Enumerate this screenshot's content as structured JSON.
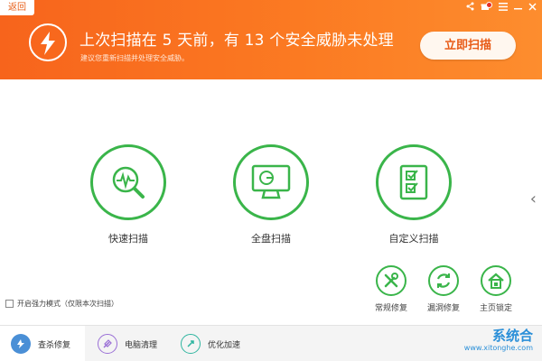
{
  "header": {
    "back_label": "返回",
    "headline": "上次扫描在 5 天前，有 13 个安全威胁未处理",
    "subline": "建议您重新扫描并处理安全威胁。",
    "scan_now_label": "立即扫描",
    "colors": {
      "bg_start": "#f7641c",
      "bg_end": "#fd8d2e",
      "accent_green": "#3ab54a"
    }
  },
  "window_controls": {
    "share": "share-icon",
    "gift": "gift-icon",
    "menu": "menu-icon",
    "minimize": "minimize-icon",
    "close": "close-icon"
  },
  "scan_options": [
    {
      "label": "快速扫描",
      "icon": "quick-scan-icon"
    },
    {
      "label": "全盘扫描",
      "icon": "full-scan-icon"
    },
    {
      "label": "自定义扫描",
      "icon": "custom-scan-icon"
    }
  ],
  "tools": [
    {
      "label": "常规修复",
      "icon": "wrench-icon"
    },
    {
      "label": "漏洞修复",
      "icon": "patch-icon"
    },
    {
      "label": "主页锁定",
      "icon": "home-lock-icon"
    }
  ],
  "force_mode": {
    "label": "开启强力模式（仅限本次扫描）",
    "checked": false
  },
  "bottom_tabs": [
    {
      "label": "查杀修复",
      "icon": "shield-scan-icon",
      "active": true
    },
    {
      "label": "电脑清理",
      "icon": "broom-icon",
      "active": false
    },
    {
      "label": "优化加速",
      "icon": "rocket-icon",
      "active": false
    }
  ],
  "watermark": {
    "brand": "系统合",
    "url": "www.xitonghe.com"
  }
}
